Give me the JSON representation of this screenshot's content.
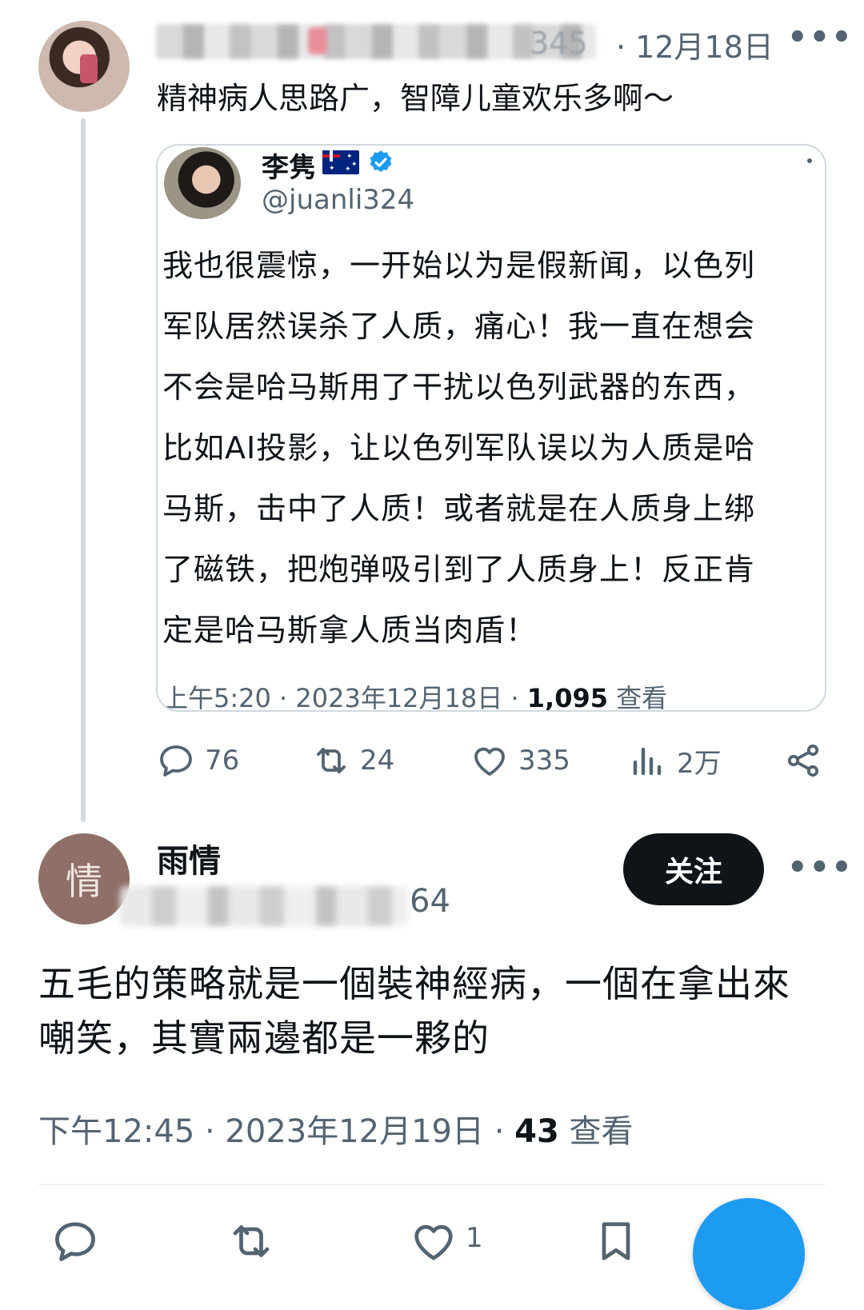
{
  "parent_tweet": {
    "handle_tail": "345",
    "date": "· 12月18日",
    "more": "•••",
    "text": "精神病人思路广，智障儿童欢乐多啊～"
  },
  "quoted": {
    "name": "李隽",
    "handle": "@juanli324",
    "lines": [
      "我也很震惊，一开始以为是假新闻，以色列",
      "军队居然误杀了人质，痛心！我一直在想会",
      "不会是哈马斯用了干扰以色列武器的东西，",
      "比如AI投影，让以色列军队误以为人质是哈",
      "马斯，击中了人质！或者就是在人质身上绑",
      "了磁铁，把炮弹吸引到了人质身上！反正肯",
      "定是哈马斯拿人质当肉盾！"
    ],
    "meta_prefix": "上午5:20 · 2023年12月18日 · ",
    "views": "1,095",
    "views_label": " 查看"
  },
  "actions": {
    "reply": "76",
    "retweet": "24",
    "like": "335",
    "views": "2万"
  },
  "reply_tweet": {
    "avatar_char": "情",
    "name": "雨情",
    "handle_tail": "64",
    "follow_label": "关注",
    "more": "•••",
    "lines": [
      "五毛的策略就是一個裝神經病，一個在拿出來",
      "嘲笑，其實兩邊都是一夥的"
    ],
    "meta_prefix": "下午12:45 · 2023年12月19日 · ",
    "views": "43",
    "views_label": " 查看",
    "like_count": "1"
  },
  "colors": {
    "text": "#0f1419",
    "secondary": "#536471",
    "accent": "#1d9bf0",
    "verified": "#1d9bf0",
    "border": "#cfd9de"
  }
}
